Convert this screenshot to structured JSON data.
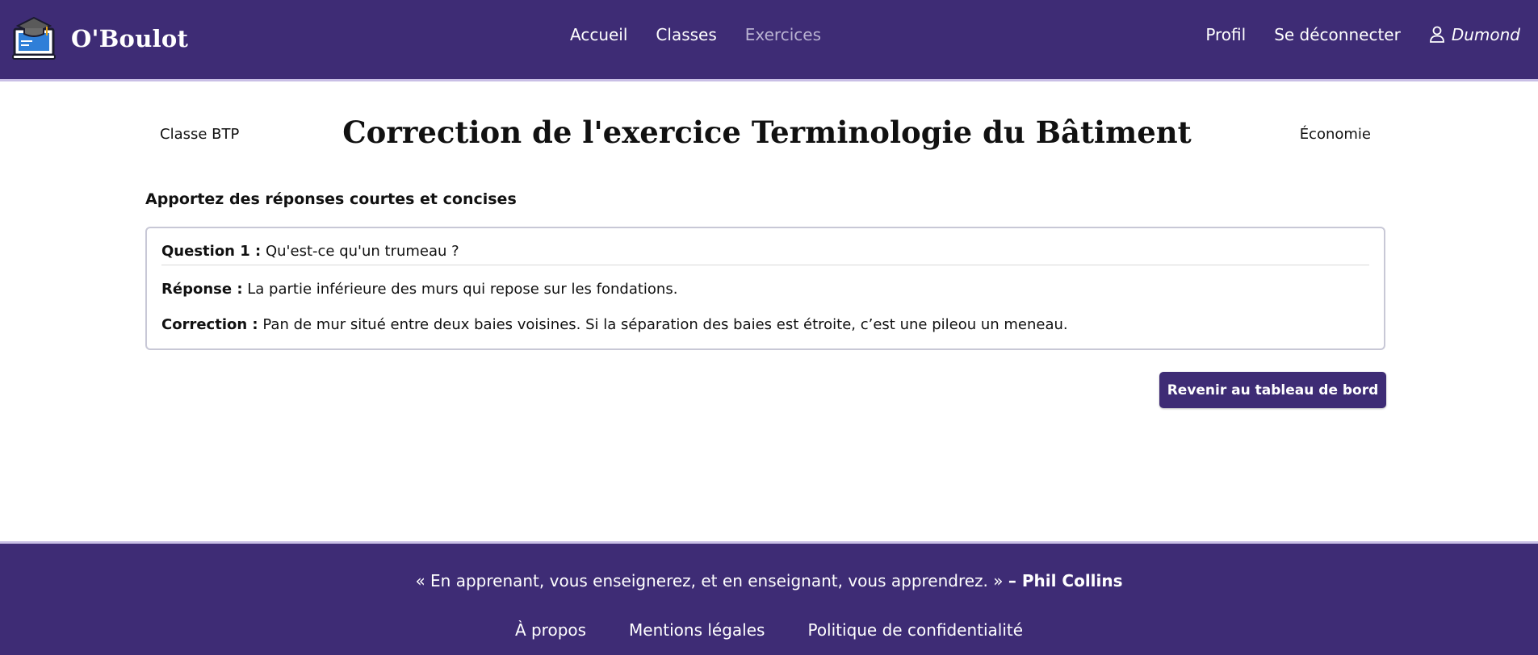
{
  "brand": {
    "name": "O'Boulot"
  },
  "nav": {
    "items": [
      {
        "label": "Accueil"
      },
      {
        "label": "Classes"
      },
      {
        "label": "Exercices"
      }
    ],
    "profile": "Profil",
    "logout": "Se déconnecter",
    "user_name": "Dumond"
  },
  "page": {
    "class_label": "Classe BTP",
    "title": "Correction de l'exercice Terminologie du Bâtiment",
    "subject": "Économie",
    "instruction": "Apportez des réponses courtes et concises"
  },
  "question": {
    "question_label": "Question 1 :",
    "question_text": "Qu'est-ce qu'un trumeau ?",
    "answer_label": "Réponse :",
    "answer_text": "La partie inférieure des murs qui repose sur les fondations.",
    "correction_label": "Correction :",
    "correction_text": "Pan de mur situé entre deux baies voisines. Si la séparation des baies est étroite, c’est une pileou un meneau."
  },
  "actions": {
    "back_label": "Revenir au tableau de bord"
  },
  "footer": {
    "quote": "« En apprenant, vous enseignerez, et en enseignant, vous apprendrez. »",
    "author": "– Phil Collins",
    "links": [
      {
        "label": "À propos"
      },
      {
        "label": "Mentions légales"
      },
      {
        "label": "Politique de confidentialité"
      }
    ]
  },
  "colors": {
    "primary": "#3e2c75",
    "accent_border": "#c9bfe6",
    "active_nav": "#b9b2d2"
  },
  "icons": {
    "logo": "graduation-cap-laptop-icon",
    "user": "user-icon"
  }
}
